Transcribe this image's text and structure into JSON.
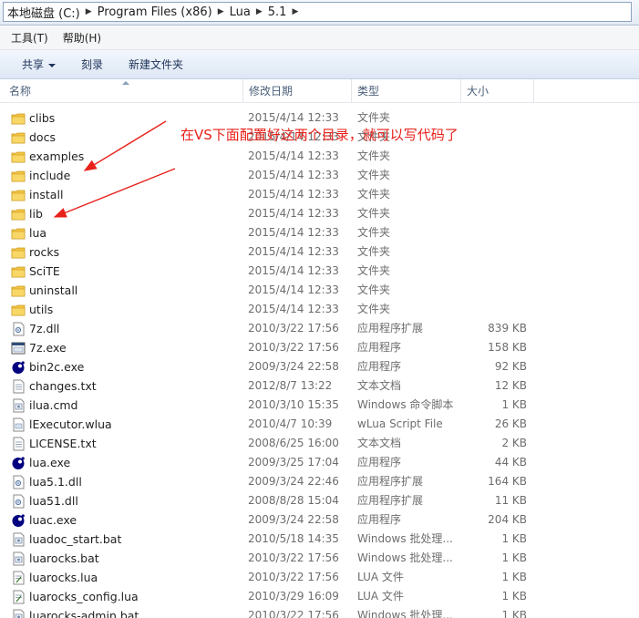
{
  "address": {
    "crumbs": [
      "本地磁盘 (C:)",
      "Program Files (x86)",
      "Lua",
      "5.1"
    ]
  },
  "menu": {
    "tools": "工具(T)",
    "help": "帮助(H)"
  },
  "toolbar": {
    "share": "共享",
    "burn": "刻录",
    "new_folder": "新建文件夹"
  },
  "columns": {
    "name": "名称",
    "date": "修改日期",
    "type": "类型",
    "size": "大小"
  },
  "annotation": "在VS下面配置好这两个目录，就可以写代码了",
  "colors": {
    "annotation": "#e8211a",
    "folder": "#f5c543"
  },
  "files": [
    {
      "name": "clibs",
      "date": "2015/4/14 12:33",
      "type": "文件夹",
      "size": "",
      "icon": "folder-icon"
    },
    {
      "name": "docs",
      "date": "2015/4/14 12:33",
      "type": "文件夹",
      "size": "",
      "icon": "folder-icon"
    },
    {
      "name": "examples",
      "date": "2015/4/14 12:33",
      "type": "文件夹",
      "size": "",
      "icon": "folder-icon"
    },
    {
      "name": "include",
      "date": "2015/4/14 12:33",
      "type": "文件夹",
      "size": "",
      "icon": "folder-icon"
    },
    {
      "name": "install",
      "date": "2015/4/14 12:33",
      "type": "文件夹",
      "size": "",
      "icon": "folder-icon"
    },
    {
      "name": "lib",
      "date": "2015/4/14 12:33",
      "type": "文件夹",
      "size": "",
      "icon": "folder-icon"
    },
    {
      "name": "lua",
      "date": "2015/4/14 12:33",
      "type": "文件夹",
      "size": "",
      "icon": "folder-icon"
    },
    {
      "name": "rocks",
      "date": "2015/4/14 12:33",
      "type": "文件夹",
      "size": "",
      "icon": "folder-icon"
    },
    {
      "name": "SciTE",
      "date": "2015/4/14 12:33",
      "type": "文件夹",
      "size": "",
      "icon": "folder-icon"
    },
    {
      "name": "uninstall",
      "date": "2015/4/14 12:33",
      "type": "文件夹",
      "size": "",
      "icon": "folder-icon"
    },
    {
      "name": "utils",
      "date": "2015/4/14 12:33",
      "type": "文件夹",
      "size": "",
      "icon": "folder-icon"
    },
    {
      "name": "7z.dll",
      "date": "2010/3/22 17:56",
      "type": "应用程序扩展",
      "size": "839 KB",
      "icon": "dll-icon"
    },
    {
      "name": "7z.exe",
      "date": "2010/3/22 17:56",
      "type": "应用程序",
      "size": "158 KB",
      "icon": "exe-window-icon"
    },
    {
      "name": "bin2c.exe",
      "date": "2009/3/24 22:58",
      "type": "应用程序",
      "size": "92 KB",
      "icon": "lua-globe-icon"
    },
    {
      "name": "changes.txt",
      "date": "2012/8/7 13:22",
      "type": "文本文档",
      "size": "12 KB",
      "icon": "text-file-icon"
    },
    {
      "name": "ilua.cmd",
      "date": "2010/3/10 15:35",
      "type": "Windows 命令脚本",
      "size": "1 KB",
      "icon": "cmd-file-icon"
    },
    {
      "name": "lExecutor.wlua",
      "date": "2010/4/7 10:39",
      "type": "wLua Script File",
      "size": "26 KB",
      "icon": "script-file-icon"
    },
    {
      "name": "LICENSE.txt",
      "date": "2008/6/25 16:00",
      "type": "文本文档",
      "size": "2 KB",
      "icon": "text-file-icon"
    },
    {
      "name": "lua.exe",
      "date": "2009/3/25 17:04",
      "type": "应用程序",
      "size": "44 KB",
      "icon": "lua-globe-icon"
    },
    {
      "name": "lua5.1.dll",
      "date": "2009/3/24 22:46",
      "type": "应用程序扩展",
      "size": "164 KB",
      "icon": "dll-icon"
    },
    {
      "name": "lua51.dll",
      "date": "2008/8/28 15:04",
      "type": "应用程序扩展",
      "size": "11 KB",
      "icon": "dll-icon"
    },
    {
      "name": "luac.exe",
      "date": "2009/3/24 22:58",
      "type": "应用程序",
      "size": "204 KB",
      "icon": "lua-globe-icon"
    },
    {
      "name": "luadoc_start.bat",
      "date": "2010/5/18 14:35",
      "type": "Windows 批处理...",
      "size": "1 KB",
      "icon": "bat-file-icon"
    },
    {
      "name": "luarocks.bat",
      "date": "2010/3/22 17:56",
      "type": "Windows 批处理...",
      "size": "1 KB",
      "icon": "bat-file-icon"
    },
    {
      "name": "luarocks.lua",
      "date": "2010/3/22 17:56",
      "type": "LUA 文件",
      "size": "1 KB",
      "icon": "lua-file-icon"
    },
    {
      "name": "luarocks_config.lua",
      "date": "2010/3/29 16:09",
      "type": "LUA 文件",
      "size": "1 KB",
      "icon": "lua-file-icon"
    },
    {
      "name": "luarocks-admin.bat",
      "date": "2010/3/22 17:56",
      "type": "Windows 批处理...",
      "size": "1 KB",
      "icon": "bat-file-icon"
    }
  ]
}
